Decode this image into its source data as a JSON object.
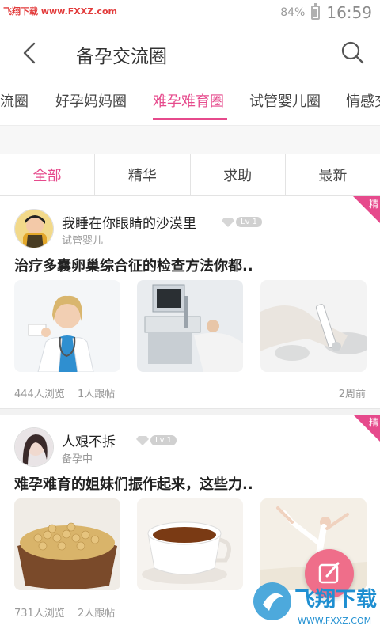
{
  "status_bar": {
    "watermark": "飞翔下载 www.FXXZ.com",
    "battery": "84%",
    "time": "16:59"
  },
  "header": {
    "title": "备孕交流圈"
  },
  "category_tabs": [
    {
      "label": "交流圈",
      "active": false
    },
    {
      "label": "好孕妈妈圈",
      "active": false
    },
    {
      "label": "难孕难育圈",
      "active": true
    },
    {
      "label": "试管婴儿圈",
      "active": false
    },
    {
      "label": "情感交",
      "active": false
    }
  ],
  "filter_tabs": [
    {
      "label": "全部",
      "active": true
    },
    {
      "label": "精华",
      "active": false
    },
    {
      "label": "求助",
      "active": false
    },
    {
      "label": "最新",
      "active": false
    }
  ],
  "posts": [
    {
      "badge": "精",
      "author": "我睡在你眼睛的沙漠里",
      "level": "Lv 1",
      "circle": "试管婴儿",
      "title": "治疗多囊卵巢综合征的检查方法你都..",
      "views": "444人浏览",
      "replies": "1人跟帖",
      "time": "2周前"
    },
    {
      "badge": "精",
      "author": "人艰不拆",
      "level": "Lv 1",
      "circle": "备孕中",
      "title": "难孕难育的姐妹们振作起来，这些力..",
      "views": "731人浏览",
      "replies": "2人跟帖",
      "time": ""
    }
  ],
  "bottom_watermark": {
    "text": "飞翔下载",
    "url": "WWW.FXXZ.COM"
  },
  "colors": {
    "accent": "#e64a8c"
  }
}
